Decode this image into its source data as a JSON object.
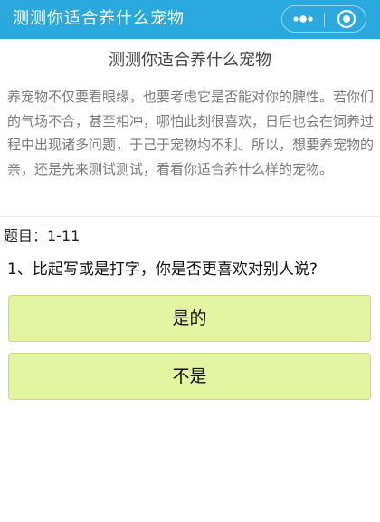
{
  "navbar": {
    "title": "测测你适合养什么宠物",
    "more_icon": "more-icon",
    "close_icon": "close-icon",
    "background_color": "#29a9de"
  },
  "main": {
    "title": "测测你适合养什么宠物",
    "intro": "养宠物不仅要看眼缘，也要考虑它是否能对你的脾性。若你们的气场不合，甚至相冲，哪怕此刻很喜欢，日后也会在饲养过程中出现诸多问题，于己于宠物均不利。所以，想要养宠物的亲，还是先来测试测试，看看你适合养什么样的宠物。",
    "question_number": "题目：1-11",
    "question": "1、比起写或是打字，你是否更喜欢对别人说?",
    "options": [
      {
        "label": "是的"
      },
      {
        "label": "不是"
      }
    ],
    "option_color": "#e3f5a0"
  }
}
